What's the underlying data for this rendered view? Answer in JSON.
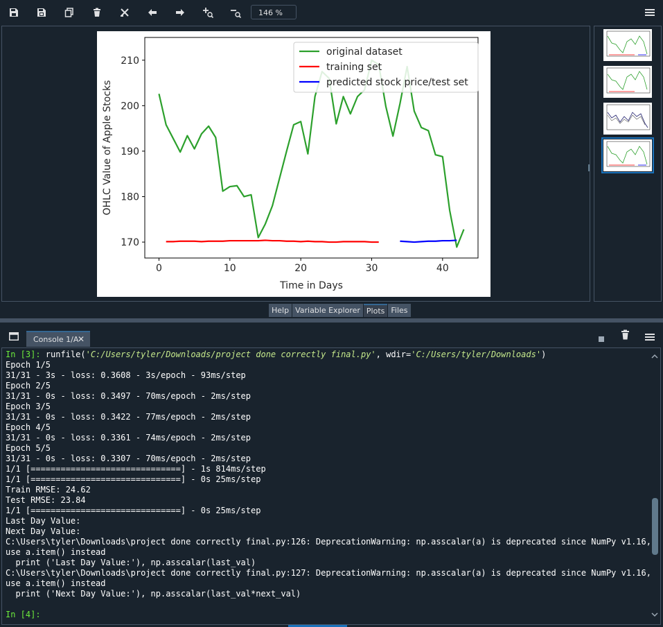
{
  "toolbar": {
    "zoom_value": "146 %",
    "icons": [
      "save-icon",
      "save-all-icon",
      "copy-icon",
      "trash-icon",
      "clear-all-icon",
      "arrow-left-icon",
      "arrow-right-icon",
      "zoom-in-icon",
      "zoom-out-icon",
      "hamburger-menu-icon"
    ]
  },
  "pane_tabs": [
    {
      "label": "Help",
      "active": false
    },
    {
      "label": "Variable Explorer",
      "active": false
    },
    {
      "label": "Plots",
      "active": true
    },
    {
      "label": "Files",
      "active": false
    }
  ],
  "console": {
    "tab_label": "Console 1/A",
    "close_glyph": "✕",
    "prompt_in3": "In [3]:",
    "cmd_prefix": " runfile(",
    "cmd_arg1": "'C:/Users/tyler/Downloads/project done correctly final.py'",
    "cmd_mid": ", wdir=",
    "cmd_arg2": "'C:/Users/tyler/Downloads'",
    "cmd_suffix": ")",
    "output_lines": [
      "Epoch 1/5",
      "31/31 - 3s - loss: 0.3608 - 3s/epoch - 93ms/step",
      "Epoch 2/5",
      "31/31 - 0s - loss: 0.3497 - 70ms/epoch - 2ms/step",
      "Epoch 3/5",
      "31/31 - 0s - loss: 0.3422 - 77ms/epoch - 2ms/step",
      "Epoch 4/5",
      "31/31 - 0s - loss: 0.3361 - 74ms/epoch - 2ms/step",
      "Epoch 5/5",
      "31/31 - 0s - loss: 0.3307 - 70ms/epoch - 2ms/step",
      "1/1 [==============================] - 1s 814ms/step",
      "1/1 [==============================] - 0s 25ms/step",
      "Train RMSE: 24.62",
      "Test RMSE: 23.84",
      "1/1 [==============================] - 0s 25ms/step",
      "Last Day Value:",
      "Next Day Value:",
      "C:\\Users\\tyler\\Downloads\\project done correctly final.py:126: DeprecationWarning: np.asscalar(a) is deprecated since NumPy v1.16,",
      "use a.item() instead",
      "  print ('Last Day Value:'), np.asscalar(last_val)",
      "C:\\Users\\tyler\\Downloads\\project done correctly final.py:127: DeprecationWarning: np.asscalar(a) is deprecated since NumPy v1.16,",
      "use a.item() instead",
      "  print ('Next Day Value:'), np.asscalar(last_val*next_val)",
      ""
    ],
    "prompt_in4": "In [4]:"
  },
  "colors": {
    "background": "#19232d",
    "border": "#455364",
    "accent": "#346792",
    "prompt_green": "#6cea3c",
    "string_green": "#c4e88b"
  },
  "chart_data": {
    "type": "line",
    "xlabel": "Time in Days",
    "ylabel": "OHLC Value of Apple Stocks",
    "xlim": [
      -2,
      45
    ],
    "ylim": [
      166.5,
      215
    ],
    "xticks": [
      0,
      10,
      20,
      30,
      40
    ],
    "yticks": [
      170,
      180,
      190,
      200,
      210
    ],
    "legend_position": "top-right",
    "series": [
      {
        "name": "original dataset",
        "color": "#2ca02c",
        "x": [
          0,
          1,
          2,
          3,
          4,
          5,
          6,
          7,
          8,
          9,
          10,
          11,
          12,
          13,
          14,
          15,
          16,
          17,
          18,
          19,
          20,
          21,
          22,
          23,
          24,
          25,
          26,
          27,
          28,
          29,
          30,
          31,
          32,
          33,
          34,
          35,
          36,
          37,
          38,
          39,
          40,
          41,
          42,
          43
        ],
        "y": [
          202.6,
          195.8,
          192.8,
          189.8,
          193.4,
          190.5,
          193.8,
          195.5,
          193.0,
          181.2,
          182.2,
          182.4,
          180.0,
          180.4,
          171.0,
          174.0,
          178.0,
          184.0,
          190.0,
          195.8,
          196.5,
          189.4,
          202.0,
          207.5,
          206.0,
          196.0,
          202.0,
          198.2,
          202.0,
          203.5,
          210.0,
          209.0,
          199.8,
          193.3,
          200.5,
          208.6,
          198.8,
          195.2,
          194.5,
          189.2,
          188.8,
          177.0,
          168.9,
          172.8
        ]
      },
      {
        "name": "training set",
        "color": "#ff0000",
        "x": [
          1,
          2,
          3,
          4,
          5,
          6,
          7,
          8,
          9,
          10,
          11,
          12,
          13,
          14,
          15,
          16,
          17,
          18,
          19,
          20,
          21,
          22,
          23,
          24,
          25,
          26,
          27,
          28,
          29,
          30,
          31
        ],
        "y": [
          170.1,
          170.1,
          170.2,
          170.2,
          170.2,
          170.1,
          170.2,
          170.2,
          170.2,
          170.3,
          170.3,
          170.3,
          170.3,
          170.3,
          170.4,
          170.3,
          170.3,
          170.2,
          170.2,
          170.1,
          170.2,
          170.1,
          170.1,
          170.0,
          170.0,
          170.1,
          170.1,
          170.1,
          170.1,
          170.0,
          170.0
        ]
      },
      {
        "name": "predicted stock price/test set",
        "color": "#0000ff",
        "x": [
          34,
          35,
          36,
          37,
          38,
          39,
          40,
          41,
          42
        ],
        "y": [
          170.2,
          170.1,
          170.0,
          170.1,
          170.2,
          170.2,
          170.3,
          170.3,
          170.4
        ]
      }
    ]
  }
}
